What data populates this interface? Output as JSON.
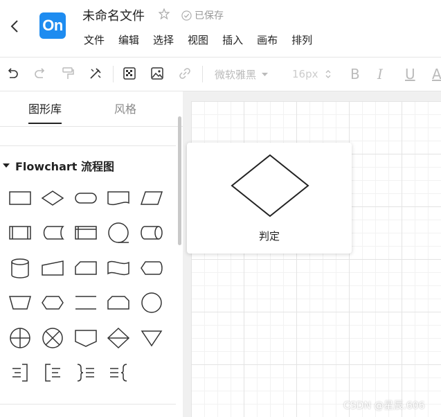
{
  "header": {
    "logo_text": "On",
    "title": "未命名文件",
    "saved_status": "已保存",
    "menu": [
      "文件",
      "编辑",
      "选择",
      "视图",
      "插入",
      "画布",
      "排列"
    ]
  },
  "toolbar": {
    "icons": [
      "undo-icon",
      "redo-icon",
      "format-painter-icon",
      "clear-format-icon",
      "fill-pattern-icon",
      "image-icon",
      "link-icon"
    ],
    "font_family": "微软雅黑",
    "font_size": "16px",
    "bold": "B",
    "italic": "I",
    "underline": "U",
    "font_color": "A"
  },
  "sidebar": {
    "tabs": [
      "图形库",
      "风格"
    ],
    "active_tab": "图形库",
    "section_title": "Flowchart 流程图",
    "shapes": [
      "process",
      "decision",
      "terminator",
      "document",
      "data",
      "predefined-process",
      "stored-data",
      "internal-storage",
      "sequential-data",
      "direct-data",
      "database",
      "manual-input",
      "card",
      "punched-tape",
      "display",
      "manual-operation",
      "preparation",
      "parallel-mode",
      "loop-limit",
      "connector",
      "or",
      "summing-junction",
      "off-page-reference",
      "sort",
      "merge",
      "annotation-right",
      "annotation-left",
      "brace-right",
      "brace-left"
    ]
  },
  "preview": {
    "label": "判定"
  },
  "watermark": "CSDN @星辰.606",
  "colors": {
    "logo_bg": "#1e8cf0",
    "accent": "#222222",
    "muted": "#999999"
  }
}
